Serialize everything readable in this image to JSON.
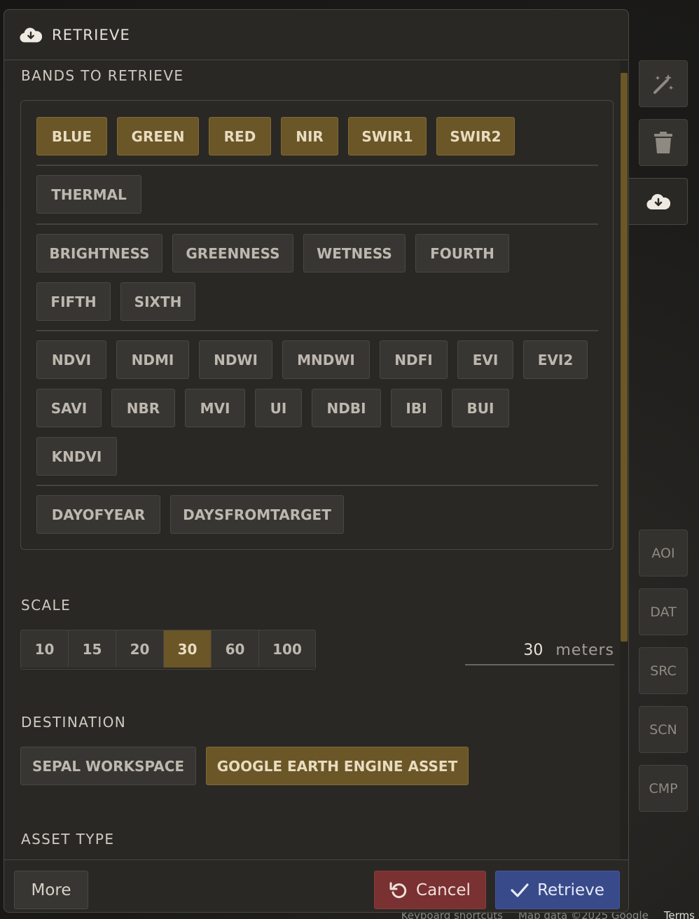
{
  "panel": {
    "title": "RETRIEVE",
    "sections": {
      "bands_label": "BANDS TO RETRIEVE",
      "scale_label": "SCALE",
      "destination_label": "DESTINATION",
      "asset_type_label": "ASSET TYPE"
    },
    "band_groups": [
      [
        {
          "label": "BLUE",
          "selected": true
        },
        {
          "label": "GREEN",
          "selected": true
        },
        {
          "label": "RED",
          "selected": true
        },
        {
          "label": "NIR",
          "selected": true
        },
        {
          "label": "SWIR1",
          "selected": true
        },
        {
          "label": "SWIR2",
          "selected": true
        }
      ],
      [
        {
          "label": "THERMAL",
          "selected": false
        }
      ],
      [
        {
          "label": "BRIGHTNESS",
          "selected": false
        },
        {
          "label": "GREENNESS",
          "selected": false
        },
        {
          "label": "WETNESS",
          "selected": false
        },
        {
          "label": "FOURTH",
          "selected": false
        },
        {
          "label": "FIFTH",
          "selected": false
        },
        {
          "label": "SIXTH",
          "selected": false
        }
      ],
      [
        {
          "label": "NDVI",
          "selected": false
        },
        {
          "label": "NDMI",
          "selected": false
        },
        {
          "label": "NDWI",
          "selected": false
        },
        {
          "label": "MNDWI",
          "selected": false
        },
        {
          "label": "NDFI",
          "selected": false
        },
        {
          "label": "EVI",
          "selected": false
        },
        {
          "label": "EVI2",
          "selected": false
        },
        {
          "label": "SAVI",
          "selected": false
        },
        {
          "label": "NBR",
          "selected": false
        },
        {
          "label": "MVI",
          "selected": false
        },
        {
          "label": "UI",
          "selected": false
        },
        {
          "label": "NDBI",
          "selected": false
        },
        {
          "label": "IBI",
          "selected": false
        },
        {
          "label": "BUI",
          "selected": false
        },
        {
          "label": "KNDVI",
          "selected": false
        }
      ],
      [
        {
          "label": "DAYOFYEAR",
          "selected": false
        },
        {
          "label": "DAYSFROMTARGET",
          "selected": false
        }
      ]
    ],
    "scale": {
      "options": [
        "10",
        "15",
        "20",
        "30",
        "60",
        "100"
      ],
      "selected": "30",
      "value": "30",
      "unit": "meters"
    },
    "destination": {
      "options": [
        {
          "label": "SEPAL WORKSPACE",
          "selected": false
        },
        {
          "label": "GOOGLE EARTH ENGINE ASSET",
          "selected": true
        }
      ]
    },
    "footer": {
      "more": "More",
      "cancel": "Cancel",
      "retrieve": "Retrieve"
    }
  },
  "side_toolbar": {
    "top_icons": [
      "magic-wand-icon",
      "trash-icon",
      "cloud-download-icon"
    ],
    "buttons": [
      "AOI",
      "DAT",
      "SRC",
      "SCN",
      "CMP"
    ]
  },
  "map_footer": {
    "items": [
      "Keyboard shortcuts",
      "Map data ©2025 Google",
      "Terms"
    ]
  },
  "colors": {
    "accent_selected": "#6b5628",
    "cancel": "#7a3131",
    "retrieve": "#384a8a"
  }
}
